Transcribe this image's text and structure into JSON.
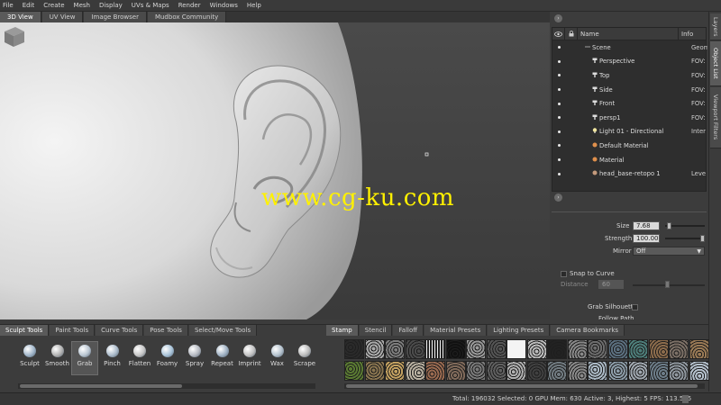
{
  "menu": [
    "File",
    "Edit",
    "Create",
    "Mesh",
    "Display",
    "UVs & Maps",
    "Render",
    "Windows",
    "Help"
  ],
  "view_tabs": [
    "3D View",
    "UV View",
    "Image Browser",
    "Mudbox Community"
  ],
  "active_view_tab": "3D View",
  "watermark": "www.cg-ku.com",
  "right_tabs": [
    "Layers",
    "Object List",
    "Viewport Filters"
  ],
  "active_right_tab": "Object List",
  "outliner": {
    "columns": {
      "name": "Name",
      "info": "Info"
    },
    "rows": [
      {
        "label": "Scene",
        "info": "Geom",
        "icon": "scene-icon",
        "indent": 0
      },
      {
        "label": "Perspective",
        "info": "FOV:",
        "icon": "camera-icon",
        "indent": 1
      },
      {
        "label": "Top",
        "info": "FOV:",
        "icon": "camera-icon",
        "indent": 1
      },
      {
        "label": "Side",
        "info": "FOV:",
        "icon": "camera-icon",
        "indent": 1
      },
      {
        "label": "Front",
        "info": "FOV:",
        "icon": "camera-icon",
        "indent": 1
      },
      {
        "label": "persp1",
        "info": "FOV:",
        "icon": "camera-icon",
        "indent": 1
      },
      {
        "label": "Light 01 - Directional",
        "info": "Inter",
        "icon": "light-icon",
        "indent": 1
      },
      {
        "label": "Default Material",
        "info": "",
        "icon": "material-icon",
        "indent": 1
      },
      {
        "label": "Material",
        "info": "",
        "icon": "material-icon",
        "indent": 1
      },
      {
        "label": "head_base-retopo 1",
        "info": "Leve",
        "icon": "mesh-icon",
        "indent": 1
      }
    ]
  },
  "props": {
    "size_label": "Size",
    "size_value": "7.68",
    "size_level": 0.05,
    "strength_label": "Strength",
    "strength_value": "100.00",
    "strength_level": 1.0,
    "mirror_label": "Mirror",
    "mirror_value": "Off",
    "snap_label": "Snap to Curve",
    "distance_label": "Distance",
    "distance_value": "60",
    "grab_silhouette_label": "Grab Silhouette",
    "follow_path_label": "Follow Path"
  },
  "tool_tabs": [
    "Sculpt Tools",
    "Paint Tools",
    "Curve Tools",
    "Pose Tools",
    "Select/Move Tools"
  ],
  "active_tool_tab": "Sculpt Tools",
  "tools": [
    {
      "label": "Sculpt",
      "color": "#9fb4c8"
    },
    {
      "label": "Smooth",
      "color": "#b0b0b0"
    },
    {
      "label": "Grab",
      "color": "#b8c4d0"
    },
    {
      "label": "Pinch",
      "color": "#a9b9c9"
    },
    {
      "label": "Flatten",
      "color": "#c4c4c4"
    },
    {
      "label": "Foamy",
      "color": "#a7c2d8"
    },
    {
      "label": "Spray",
      "color": "#b4b8c0"
    },
    {
      "label": "Repeat",
      "color": "#9eb0c2"
    },
    {
      "label": "Imprint",
      "color": "#c0c0c0"
    },
    {
      "label": "Wax",
      "color": "#b2c0cc"
    },
    {
      "label": "Scrape",
      "color": "#b9b9b9"
    }
  ],
  "active_tool": "Grab",
  "stamp_tabs": [
    "Stamp",
    "Stencil",
    "Falloff",
    "Material Presets",
    "Lighting Presets",
    "Camera Bookmarks"
  ],
  "active_stamp_tab": "Stamp",
  "status": "Total: 196032  Selected: 0  GPU Mem: 630  Active: 3, Highest: 5  FPS: 113.565"
}
